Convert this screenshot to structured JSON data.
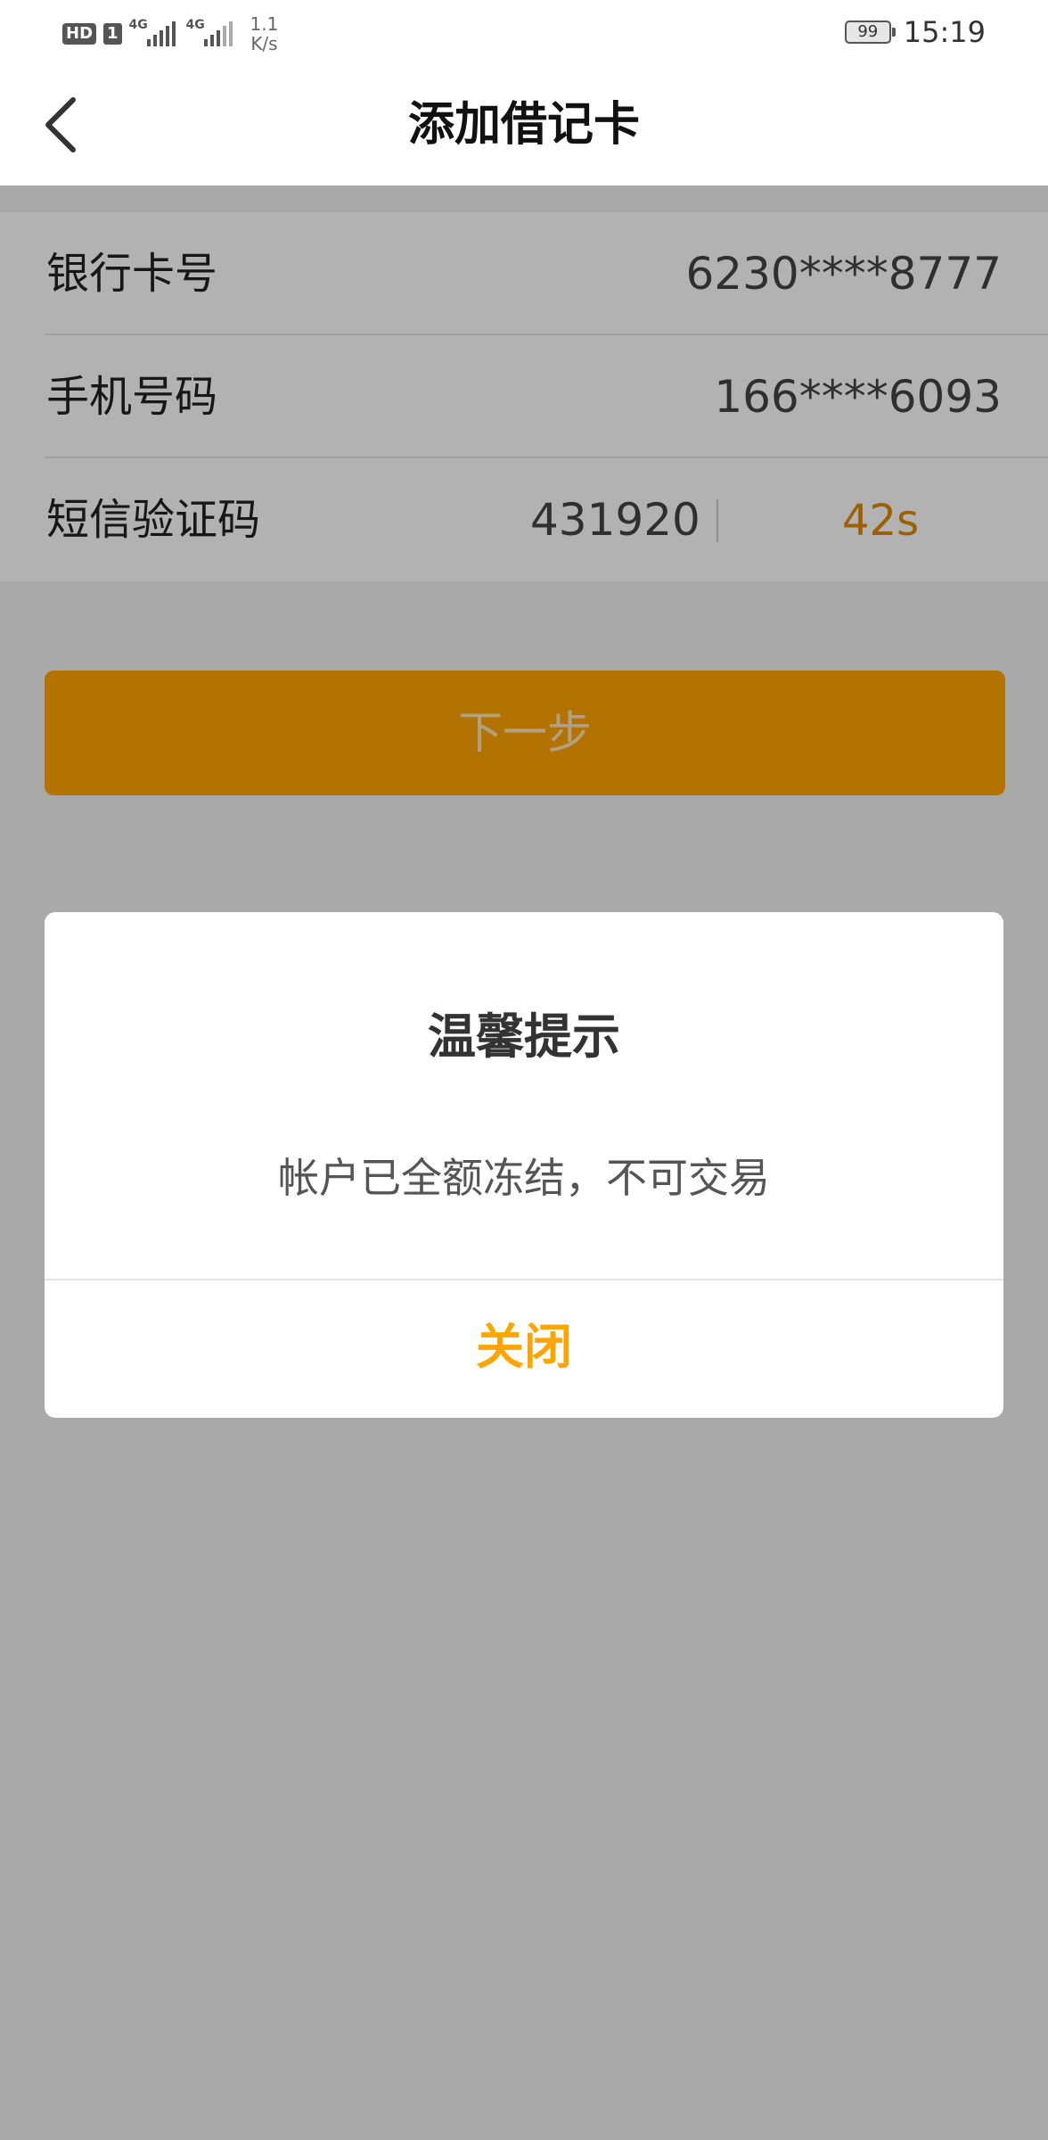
{
  "status_bar": {
    "hd": "HD",
    "sim": "1",
    "network_type_1": "4G",
    "network_type_2": "4G",
    "net_speed_value": "1.1",
    "net_speed_unit": "K/s",
    "battery": "99",
    "time": "15:19"
  },
  "nav": {
    "title": "添加借记卡",
    "back_icon": "chevron-left-icon"
  },
  "form": {
    "card_number_label": "银行卡号",
    "card_number_value": "6230****8777",
    "phone_label": "手机号码",
    "phone_value": "166****6093",
    "sms_label": "短信验证码",
    "sms_value": "431920",
    "sms_countdown": "42s"
  },
  "next_button": {
    "label": "下一步"
  },
  "dialog": {
    "title": "温馨提示",
    "message": "帐户已全额冻结，不可交易",
    "close_label": "关闭"
  },
  "colors": {
    "accent": "#ffa500",
    "countdown": "#e08a00",
    "overlay": "rgba(0,0,0,0.30)"
  }
}
